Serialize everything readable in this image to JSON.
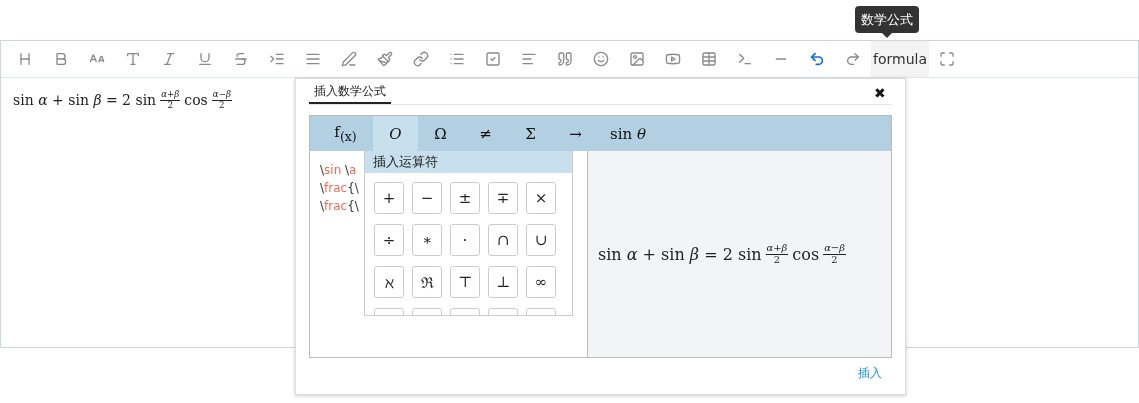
{
  "tooltip": {
    "text": "数学公式"
  },
  "toolbar": [
    {
      "kind": "icon",
      "highlighted": false
    },
    {
      "kind": "icon",
      "highlighted": false
    },
    {
      "kind": "icon",
      "highlighted": false
    },
    {
      "kind": "icon",
      "highlighted": false
    },
    {
      "kind": "icon",
      "highlighted": false
    },
    {
      "kind": "icon",
      "highlighted": false
    },
    {
      "kind": "icon",
      "highlighted": false
    },
    {
      "kind": "icon",
      "highlighted": false
    },
    {
      "kind": "icon",
      "highlighted": false
    },
    {
      "kind": "icon",
      "highlighted": false
    },
    {
      "kind": "icon",
      "highlighted": false
    },
    {
      "kind": "icon",
      "highlighted": false
    },
    {
      "kind": "icon",
      "highlighted": false
    },
    {
      "kind": "icon",
      "highlighted": false
    },
    {
      "kind": "icon",
      "highlighted": false
    },
    {
      "kind": "icon",
      "highlighted": false
    },
    {
      "kind": "icon",
      "highlighted": false
    },
    {
      "kind": "icon",
      "highlighted": false
    },
    {
      "kind": "icon",
      "highlighted": false
    },
    {
      "kind": "icon",
      "highlighted": false
    },
    {
      "kind": "icon",
      "highlighted": false
    },
    {
      "kind": "icon",
      "highlighted": false
    },
    {
      "kind": "icon",
      "highlighted": true
    },
    {
      "kind": "icon",
      "highlighted": false
    },
    {
      "kind": "text",
      "label": "formula",
      "selected": true
    },
    {
      "kind": "icon",
      "highlighted": false
    }
  ],
  "editor": {
    "formula": [
      {
        "kind": "text",
        "text": "sin *α* + sin *β* = 2 sin"
      },
      {
        "kind": "frac",
        "num": "*α*+*β*",
        "den": "2"
      },
      {
        "kind": "text",
        "text": "cos"
      },
      {
        "kind": "frac",
        "num": "*α*−*β*",
        "den": "2"
      }
    ]
  },
  "dialog": {
    "tabs": [
      {
        "label": "插入数学公式",
        "selected": true
      }
    ],
    "close": "✖",
    "categories": [
      {
        "label": "f$_{(x)}$",
        "selected": false
      },
      {
        "label": "O",
        "selected": true
      },
      {
        "label": "Ω",
        "selected": false
      },
      {
        "label": "≠",
        "selected": false
      },
      {
        "label": "Σ",
        "selected": false
      },
      {
        "label": "→",
        "selected": false
      },
      {
        "label": "sin *θ*",
        "selected": false
      }
    ],
    "code_lines": [
      [
        {
          "kind": "plain",
          "text": "\\"
        },
        {
          "kind": "command",
          "text": "sin"
        },
        {
          "kind": "plain",
          "text": " \\"
        },
        {
          "kind": "command",
          "text": "a"
        }
      ],
      [
        {
          "kind": "plain",
          "text": "\\"
        },
        {
          "kind": "command",
          "text": "frac"
        },
        {
          "kind": "plain",
          "text": "{\\"
        }
      ],
      [
        {
          "kind": "plain",
          "text": "\\"
        },
        {
          "kind": "command",
          "text": "frac"
        },
        {
          "kind": "plain",
          "text": "{\\"
        }
      ]
    ],
    "symbol_menu": {
      "title": "插入运算符",
      "symbols": [
        "+",
        "−",
        "±",
        "∓",
        "×",
        "÷",
        "∗",
        "·",
        "∩",
        "∪",
        "ℵ",
        "ℜ",
        "⊤",
        "⊥",
        "∞"
      ]
    },
    "preview": {
      "formula": [
        {
          "kind": "text",
          "text": "sin *α* + sin *β* = 2 sin"
        },
        {
          "kind": "frac",
          "num": "*α*+*β*",
          "den": "2"
        },
        {
          "kind": "text",
          "text": "cos"
        },
        {
          "kind": "frac",
          "num": "*α*−*β*",
          "den": "2"
        }
      ]
    },
    "insert_link": "插入"
  }
}
